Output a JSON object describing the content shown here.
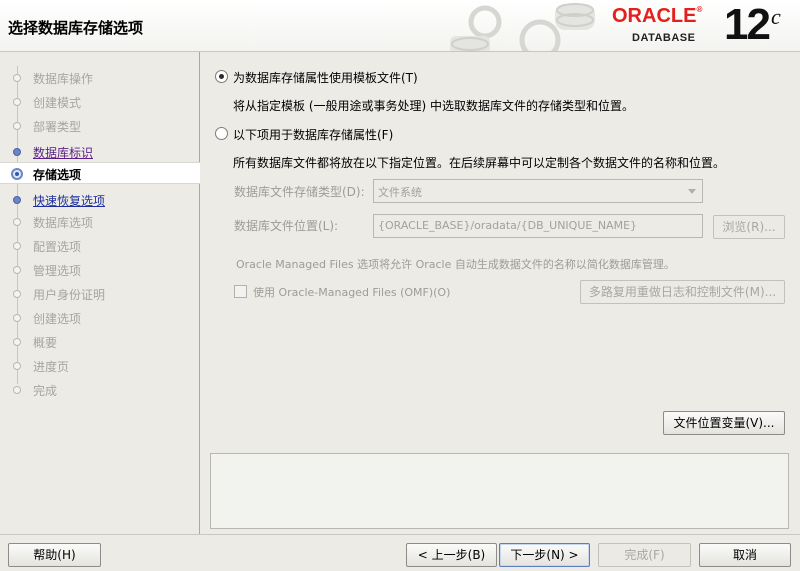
{
  "header": {
    "title": "选择数据库存储选项",
    "brand": "ORACLE",
    "brand_sub": "DATABASE",
    "version": "12",
    "version_suffix": "c"
  },
  "sidebar": {
    "steps": [
      {
        "label": "数据库操作",
        "state": "inactive"
      },
      {
        "label": "创建模式",
        "state": "inactive"
      },
      {
        "label": "部署类型",
        "state": "inactive"
      },
      {
        "label": "数据库标识",
        "state": "visited"
      },
      {
        "label": "存储选项",
        "state": "current"
      },
      {
        "label": "快速恢复选项",
        "state": "link"
      },
      {
        "label": "数据库选项",
        "state": "inactive"
      },
      {
        "label": "配置选项",
        "state": "inactive"
      },
      {
        "label": "管理选项",
        "state": "inactive"
      },
      {
        "label": "用户身份证明",
        "state": "inactive"
      },
      {
        "label": "创建选项",
        "state": "inactive"
      },
      {
        "label": "概要",
        "state": "inactive"
      },
      {
        "label": "进度页",
        "state": "inactive"
      },
      {
        "label": "完成",
        "state": "inactive"
      }
    ]
  },
  "main": {
    "option_template": {
      "label": "为数据库存储属性使用模板文件(T)",
      "selected": true,
      "description": "将从指定模板 (一般用途或事务处理) 中选取数据库文件的存储类型和位置。"
    },
    "option_custom": {
      "label": "以下项用于数据库存储属性(F)",
      "selected": false,
      "description": "所有数据库文件都将放在以下指定位置。在后续屏幕中可以定制各个数据文件的名称和位置。"
    },
    "storage_type": {
      "label": "数据库文件存储类型(D):",
      "value": "文件系统"
    },
    "file_location": {
      "label": "数据库文件位置(L):",
      "value": "{ORACLE_BASE}/oradata/{DB_UNIQUE_NAME}",
      "browse_label": "浏览(R)..."
    },
    "omf_note": "Oracle Managed Files 选项将允许 Oracle 自动生成数据文件的名称以简化数据库管理。",
    "omf_checkbox_label": "使用 Oracle-Managed Files (OMF)(O)",
    "multiplex_button": "多路复用重做日志和控制文件(M)...",
    "file_location_vars_button": "文件位置变量(V)..."
  },
  "footer": {
    "help": "帮助(H)",
    "back": "< 上一步(B)",
    "next": "下一步(N) >",
    "finish": "完成(F)",
    "cancel": "取消"
  },
  "colors": {
    "oracle_red": "#e3201b",
    "visited_link": "#5a1f86",
    "link": "#1e2f9c"
  }
}
